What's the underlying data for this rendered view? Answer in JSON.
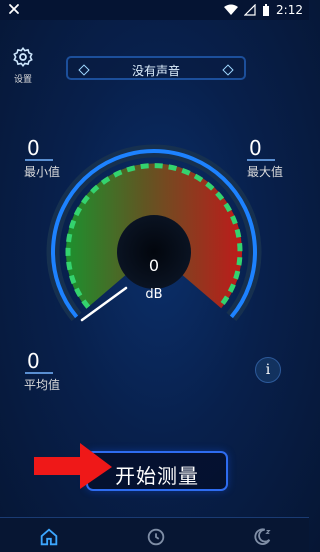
{
  "status_bar": {
    "time": "2:12"
  },
  "settings": {
    "label": "设置"
  },
  "mode_selector": {
    "value": "没有声音"
  },
  "stats": {
    "min": {
      "value": "0",
      "label": "最小值"
    },
    "max": {
      "value": "0",
      "label": "最大值"
    },
    "avg": {
      "value": "0",
      "label": "平均值"
    }
  },
  "gauge": {
    "value": "0",
    "unit": "dB",
    "level": 0
  },
  "info": {
    "label": "i"
  },
  "start_button": {
    "label": "开始测量"
  },
  "colors": {
    "accent": "#2e6cf0",
    "background": "#08204c",
    "gauge_green": "#36b13b",
    "gauge_yellow": "#e7c300",
    "gauge_red": "#e01b16"
  },
  "bottom_nav": {
    "items": [
      "home-icon",
      "clock-icon",
      "moon-icon"
    ]
  }
}
